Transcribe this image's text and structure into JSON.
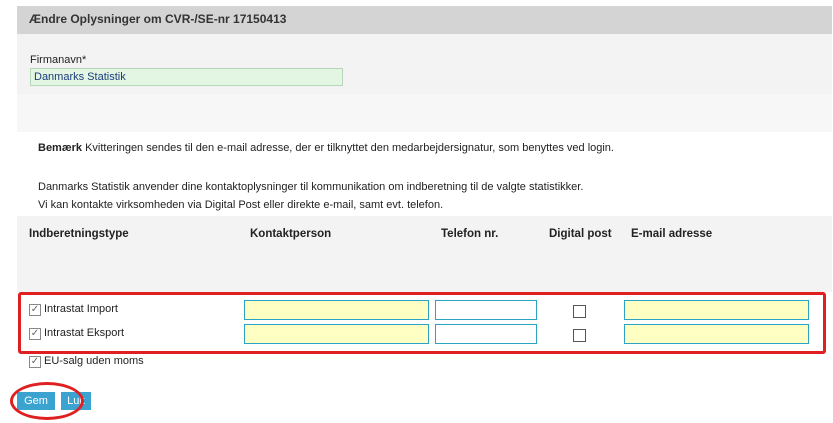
{
  "header": {
    "title": "Ændre Oplysninger om CVR-/SE-nr 17150413"
  },
  "company": {
    "label": "Firmanavn*",
    "value": "Danmarks Statistik"
  },
  "notes": {
    "bold": "Bemærk",
    "receipt": " Kvitteringen sendes til den e-mail adresse, der er tilknyttet den medarbejdersignatur, som benyttes ved login.",
    "line1": "Danmarks Statistik anvender dine kontaktoplysninger til kommunikation om indberetning til de valgte statistikker.",
    "line2": "Vi kan kontakte virksomheden via Digital Post eller direkte e-mail, samt evt. telefon."
  },
  "table": {
    "headers": {
      "type": "Indberetningstype",
      "contact": "Kontaktperson",
      "phone": "Telefon nr.",
      "digital": "Digital post",
      "email": "E-mail adresse"
    },
    "rows": [
      {
        "label": "Intrastat Import",
        "checked": true,
        "contact": "",
        "phone": "",
        "digital_post": false,
        "email": ""
      },
      {
        "label": "Intrastat Eksport",
        "checked": true,
        "contact": "",
        "phone": "",
        "digital_post": false,
        "email": ""
      },
      {
        "label": "EU-salg uden moms",
        "checked": true
      }
    ]
  },
  "buttons": {
    "save": "Gem",
    "close": "Luk"
  },
  "colors": {
    "highlight": "#e02020",
    "button": "#3ba3d0",
    "required_field": "#ffffc4",
    "company_field": "#e3f6e3"
  }
}
